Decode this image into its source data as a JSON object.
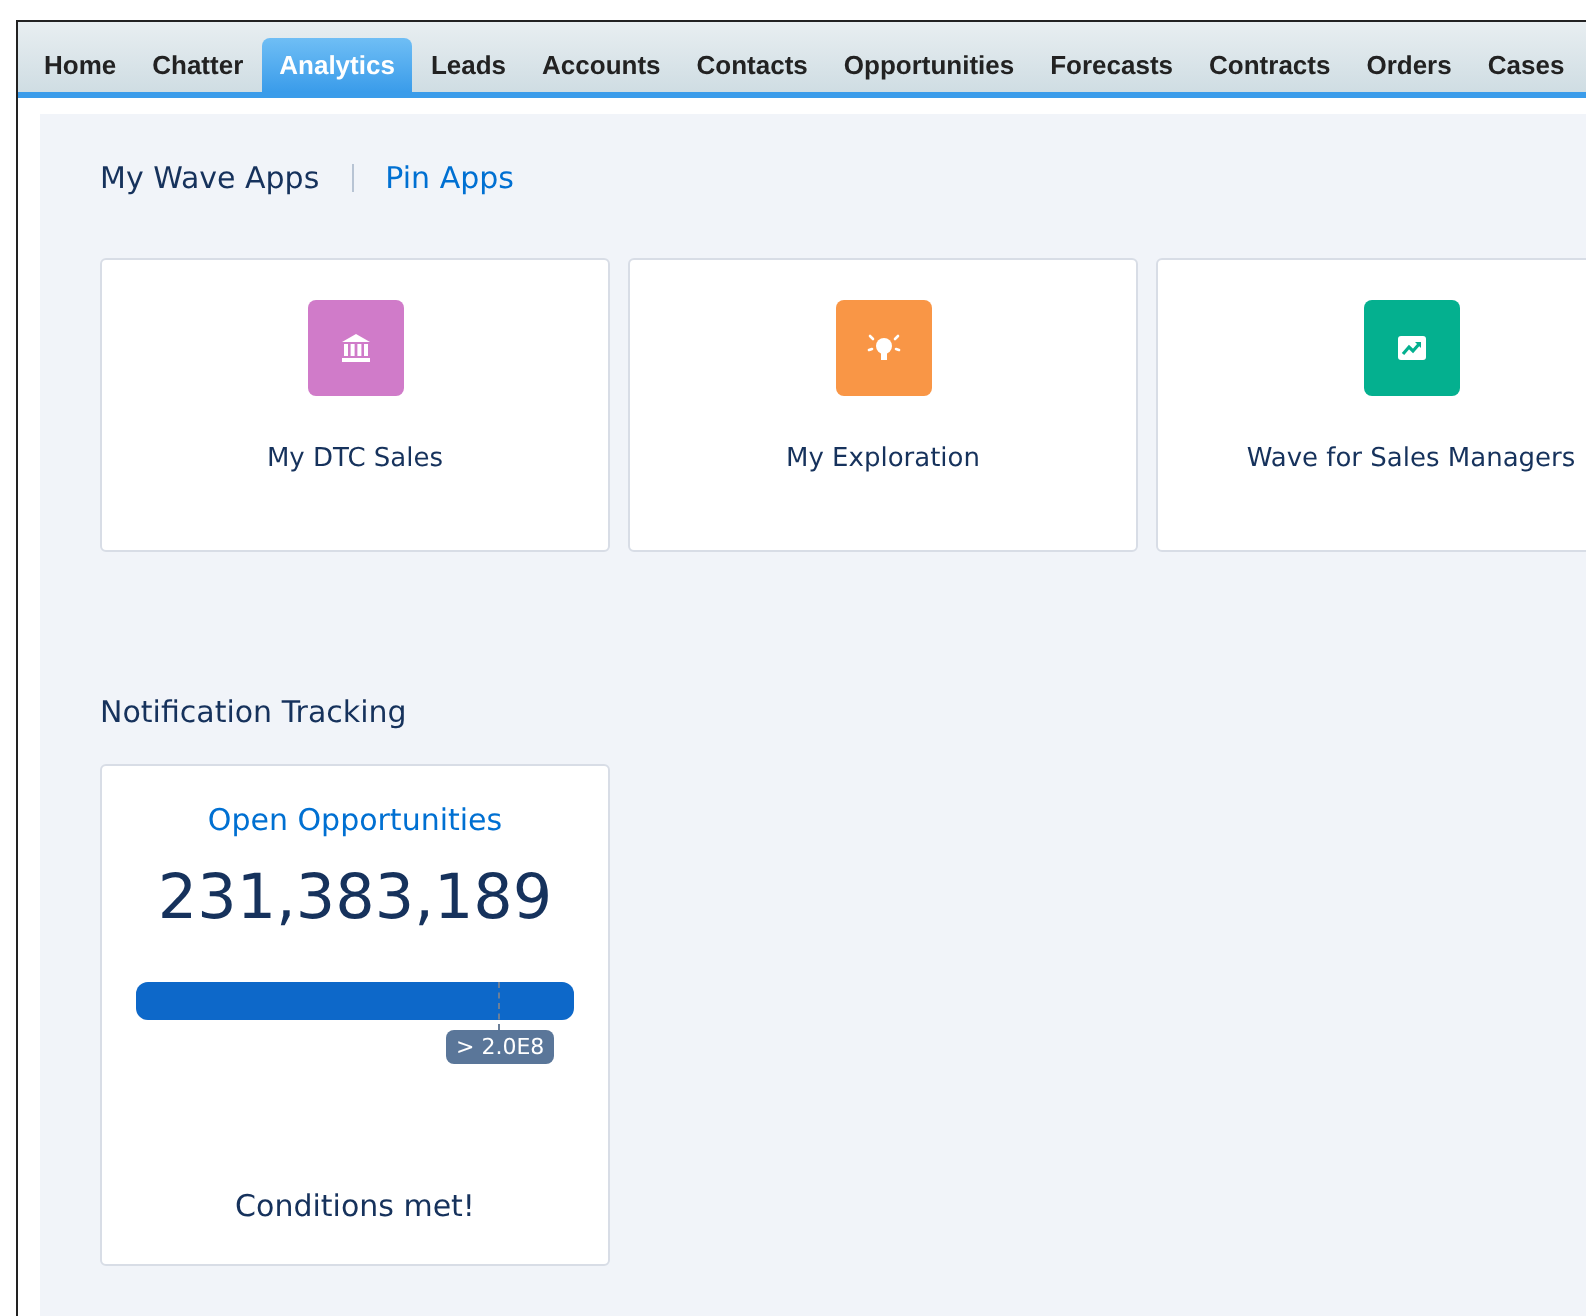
{
  "tabs": [
    {
      "label": "Home",
      "selected": false
    },
    {
      "label": "Chatter",
      "selected": false
    },
    {
      "label": "Analytics",
      "selected": true
    },
    {
      "label": "Leads",
      "selected": false
    },
    {
      "label": "Accounts",
      "selected": false
    },
    {
      "label": "Contacts",
      "selected": false
    },
    {
      "label": "Opportunities",
      "selected": false
    },
    {
      "label": "Forecasts",
      "selected": false
    },
    {
      "label": "Contracts",
      "selected": false
    },
    {
      "label": "Orders",
      "selected": false
    },
    {
      "label": "Cases",
      "selected": false
    }
  ],
  "apps_header": {
    "title": "My Wave Apps",
    "link": "Pin Apps"
  },
  "apps": [
    {
      "name": "My DTC Sales",
      "color": "#d07bc9"
    },
    {
      "name": "My Exploration",
      "color": "#f99646"
    },
    {
      "name": "Wave for Sales Managers",
      "color": "#04b08f"
    }
  ],
  "notification_tracking": {
    "title": "Notification Tracking",
    "card": {
      "title": "Open Opportunities",
      "value": "231,383,189",
      "level": 1,
      "threshold_label": "> 2.0E8",
      "status": "Conditions met!"
    }
  }
}
